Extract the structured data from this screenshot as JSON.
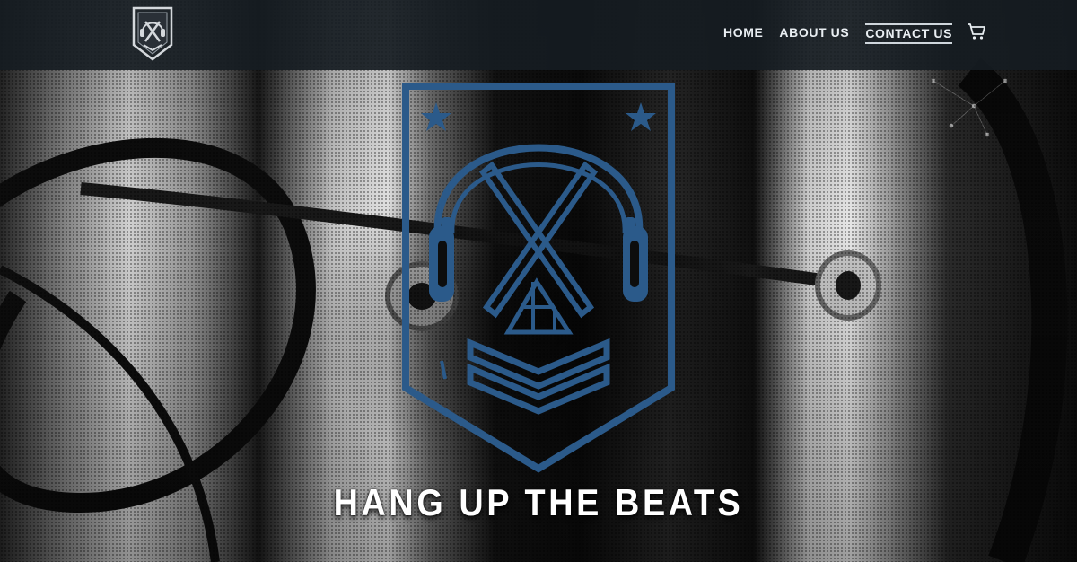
{
  "nav": {
    "items": [
      {
        "label": "HOME"
      },
      {
        "label": "ABOUT US"
      },
      {
        "label": "CONTACT US",
        "active": true
      }
    ],
    "cart_icon": "shopping-cart-icon"
  },
  "brand": {
    "logo_icon": "shield-headphones-logo"
  },
  "hero": {
    "headline": "HANG UP THE BEATS",
    "crest_icon": "headphones-crest-logo",
    "crest_color": "#2b5a8a"
  },
  "colors": {
    "nav_background": "#161c22",
    "nav_text": "#e9eef2",
    "headline_text": "#ffffff"
  }
}
